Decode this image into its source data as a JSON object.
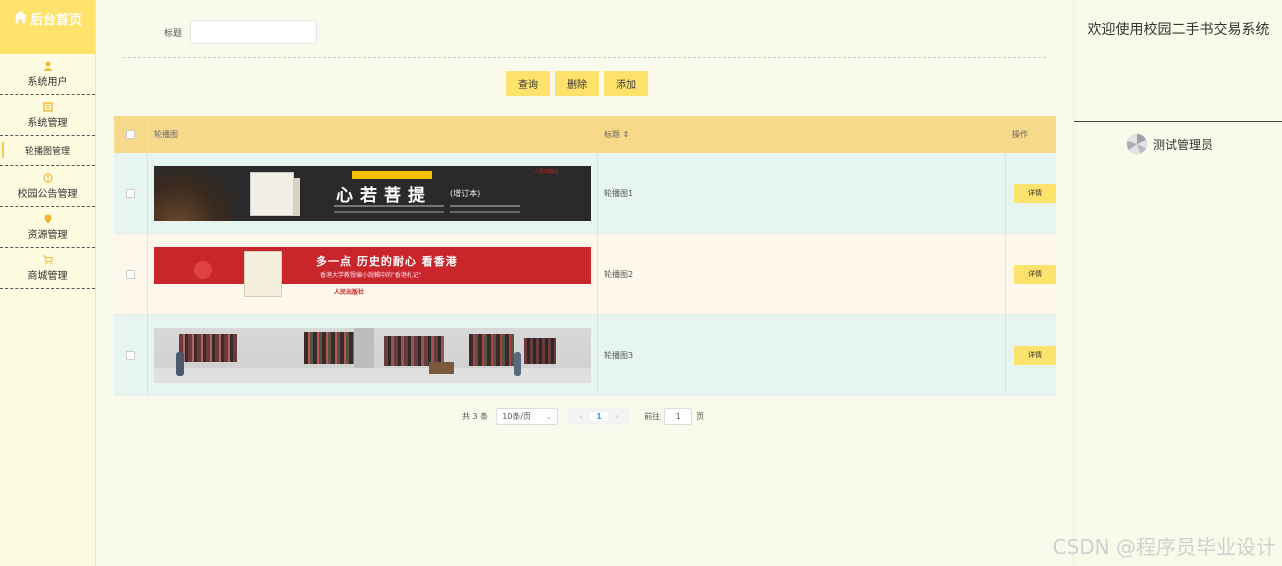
{
  "sidebar": {
    "home_label": "后台首页",
    "items": [
      {
        "label": "系统用户",
        "icon": "user-icon"
      },
      {
        "label": "系统管理",
        "icon": "settings-icon"
      },
      {
        "label": "轮播图管理",
        "icon": "",
        "sub": true
      },
      {
        "label": "校园公告管理",
        "icon": "info-icon"
      },
      {
        "label": "资源管理",
        "icon": "location-icon"
      },
      {
        "label": "商城管理",
        "icon": "cart-icon"
      }
    ]
  },
  "right": {
    "welcome": "欢迎使用校园二手书交易系统",
    "username": "测试管理员"
  },
  "search": {
    "label": "标题",
    "value": ""
  },
  "toolbar": {
    "query": "查询",
    "delete": "删除",
    "add": "添加"
  },
  "table": {
    "headers": {
      "image": "轮播图",
      "title": "标题 ⇕",
      "action": "操作"
    },
    "rows": [
      {
        "title": "轮播图1",
        "action": "详情",
        "banner_text": "心若菩提",
        "banner_sub": "(增订本)",
        "banner_tag": "人民出版社"
      },
      {
        "title": "轮播图2",
        "action": "详情",
        "banner_text": "多一点 历史的耐心 看香港",
        "banner_sub": "香港大学教授编小說輯中的\"香港札记\"",
        "banner_tag": "人民出版社"
      },
      {
        "title": "轮播图3",
        "action": "详情",
        "banner_text": "",
        "banner_sub": "",
        "banner_tag": ""
      }
    ]
  },
  "pager": {
    "total": "共 3 条",
    "page_size": "10条/页",
    "current": "1",
    "goto_label": "前往",
    "goto_value": "1",
    "page_unit": "页"
  },
  "watermark": "CSDN @程序员毕业设计",
  "colors": {
    "accent": "#fde36b",
    "header": "#f7d98b",
    "row_alt": "#e6f5f0"
  }
}
